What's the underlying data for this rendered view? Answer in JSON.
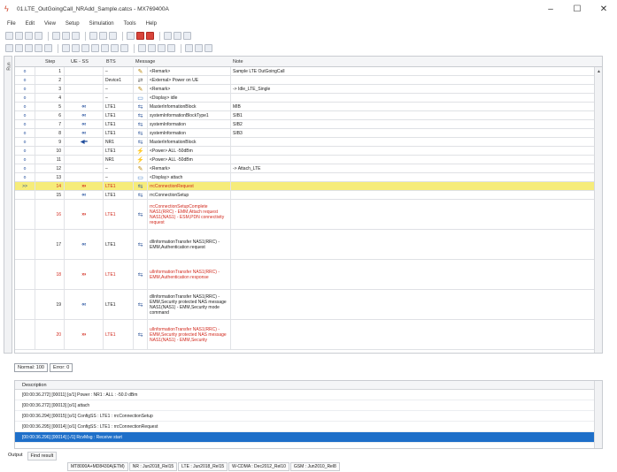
{
  "window": {
    "title": "01.LTE_OutGoingCall_NRAdd_Sample.catcs - MX769400A",
    "controls": [
      "–",
      "☐",
      "✕"
    ]
  },
  "menu": [
    "File",
    "Edit",
    "View",
    "Setup",
    "Simulation",
    "Tools",
    "Help"
  ],
  "grid": {
    "side_label": "Run",
    "headers": [
      "Step",
      "UE - SS",
      "BTS",
      "Message",
      "Note"
    ],
    "rows": [
      {
        "run": "o",
        "step": "1",
        "arrow": "",
        "bts": "–",
        "icon": "remark",
        "message": "<Remark>",
        "note": "Sample LTE OutGoingCall"
      },
      {
        "run": "o",
        "step": "2",
        "arrow": "",
        "bts": "Device1",
        "icon": "external",
        "message": "<External> Power on UE",
        "note": ""
      },
      {
        "run": "o",
        "step": "3",
        "arrow": "",
        "bts": "–",
        "icon": "remark",
        "message": "<Remark>",
        "note": "-> Idle_LTE_Single"
      },
      {
        "run": "o",
        "step": "4",
        "arrow": "",
        "bts": "–",
        "icon": "display",
        "message": "<Display> idle",
        "note": ""
      },
      {
        "run": "o",
        "step": "5",
        "arrow": "‹‹‹",
        "dir": "dl",
        "bts": "LTE1",
        "icon": "rrc",
        "message": "MasterInformationBlock",
        "note": "MIB"
      },
      {
        "run": "o",
        "step": "6",
        "arrow": "‹‹‹",
        "dir": "dl",
        "bts": "LTE1",
        "icon": "rrc",
        "message": "systemInformationBlockType1",
        "note": "SIB1"
      },
      {
        "run": "o",
        "step": "7",
        "arrow": "‹‹‹",
        "dir": "dl",
        "bts": "LTE1",
        "icon": "rrc",
        "message": "systemInformation",
        "note": "SIB2"
      },
      {
        "run": "o",
        "step": "8",
        "arrow": "‹‹‹",
        "dir": "dl",
        "bts": "LTE1",
        "icon": "rrc",
        "message": "systemInformation",
        "note": "SIB3"
      },
      {
        "run": "o",
        "step": "9",
        "arrow": "◀━",
        "dir": "dl",
        "bts": "NR1",
        "icon": "nr",
        "message": "MasterInformationBlock",
        "note": ""
      },
      {
        "run": "o",
        "step": "10",
        "arrow": "",
        "bts": "LTE1",
        "icon": "power",
        "message": "<Power> ALL -50dBm",
        "note": ""
      },
      {
        "run": "o",
        "step": "11",
        "arrow": "",
        "bts": "NR1",
        "icon": "power",
        "message": "<Power> ALL -50dBm",
        "note": ""
      },
      {
        "run": "o",
        "step": "12",
        "arrow": "",
        "bts": "–",
        "icon": "remark",
        "message": "<Remark>",
        "note": "-> Attach_LTE"
      },
      {
        "run": "o",
        "step": "13",
        "arrow": "",
        "bts": "–",
        "icon": "display",
        "message": "<Display> attach",
        "note": ""
      },
      {
        "run": ">>",
        "step": "14",
        "arrow": "›››",
        "dir": "ul",
        "bts": "LTE1",
        "icon": "rrc",
        "message": "rrcConnectionRequest",
        "note": "",
        "highlight": true
      },
      {
        "run": "",
        "step": "15",
        "arrow": "‹‹‹",
        "dir": "dl",
        "bts": "LTE1",
        "icon": "rrc",
        "message": "rrcConnectionSetup",
        "note": ""
      },
      {
        "run": "",
        "step": "16",
        "arrow": "›››",
        "dir": "ul",
        "bts": "LTE1",
        "icon": "rrc",
        "message": "rrcConnectionSetupComplete NAS1(RRC) - EMM,Attach request NAS1(NAS1) - ESM,PDN connectivity request",
        "note": ""
      },
      {
        "run": "",
        "step": "17",
        "arrow": "‹‹‹",
        "dir": "dl",
        "bts": "LTE1",
        "icon": "rrc",
        "message": "dlInformationTransfer NAS1(RRC) - EMM,Authentication request",
        "note": ""
      },
      {
        "run": "",
        "step": "18",
        "arrow": "›››",
        "dir": "ul",
        "bts": "LTE1",
        "icon": "rrc",
        "message": "ulInformationTransfer NAS1(RRC) - EMM,Authentication response",
        "note": ""
      },
      {
        "run": "",
        "step": "19",
        "arrow": "‹‹‹",
        "dir": "dl",
        "bts": "LTE1",
        "icon": "rrc",
        "message": "dlInformationTransfer NAS1(RRC) - EMM,Security protected NAS message NAS1(NAS1) - EMM,Security mode command",
        "note": ""
      },
      {
        "run": "",
        "step": "20",
        "arrow": "›››",
        "dir": "ul",
        "bts": "LTE1",
        "icon": "rrc",
        "message": "ulInformationTransfer NAS1(RRC) - EMM,Security protected NAS message NAS1(NAS1) - EMM,Security",
        "note": ""
      }
    ]
  },
  "counters": {
    "normal": "Normal: 100",
    "error": "Error: 0"
  },
  "log": {
    "header": "Description",
    "lines": [
      "[00:00:36.272] [00011] [o/1] Power : NR1 : ALL : -50.0 dBm",
      "[00:00:36.272] [00013] [o/1] attach",
      "[00:00:36.294] [00015] [o/1] ConfigSS : LTE1 : rrcConnectionSetup",
      "[00:00:36.295] [00014] [o/1] ConfigSS : LTE1 : rrcConnectionRequest",
      "[00:00:36.296] [00014] [-/1] RcvMsg : Receive start"
    ],
    "selected_index": 4
  },
  "output_tabs": [
    "Output",
    "Find result"
  ],
  "status": [
    "MT8000A+MD8430A(ETM)",
    "NR : Jun2018_Rel15",
    "LTE : Jun2018_Rel15",
    "W-CDMA : Dec2012_Rel10",
    "GSM : Jun2010_Rel8"
  ],
  "colors": {
    "uplink_red": "#d22a1e",
    "downlink_blue": "#1e4b9b",
    "highlight_row": "#f6ec7a",
    "selected_log": "#1e6fc9"
  }
}
